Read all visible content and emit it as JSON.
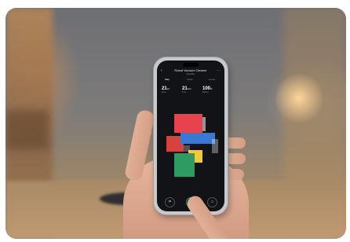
{
  "phone_app": {
    "title": "Robot Vacuum Cleaner",
    "subtitle": "Standby",
    "tabs": [
      "Map",
      "Clean",
      "Home"
    ],
    "stats": [
      {
        "value": "21",
        "unit": "m²",
        "label": "Area"
      },
      {
        "value": "21",
        "unit": "min",
        "label": "Time"
      },
      {
        "value": "100",
        "unit": "%",
        "label": "Battery"
      }
    ],
    "room_colors": {
      "kitchen": "#e8424f",
      "hallway": "#3a78d6",
      "study": "#d9423c",
      "bathroom": "#f0c93a",
      "bedroom": "#2d9b62"
    },
    "icons": {
      "back": "chevron-left-icon",
      "more": "ellipsis-icon",
      "map_edit": "crop-icon",
      "start": "power-icon",
      "dock": "home-dock-icon"
    }
  }
}
